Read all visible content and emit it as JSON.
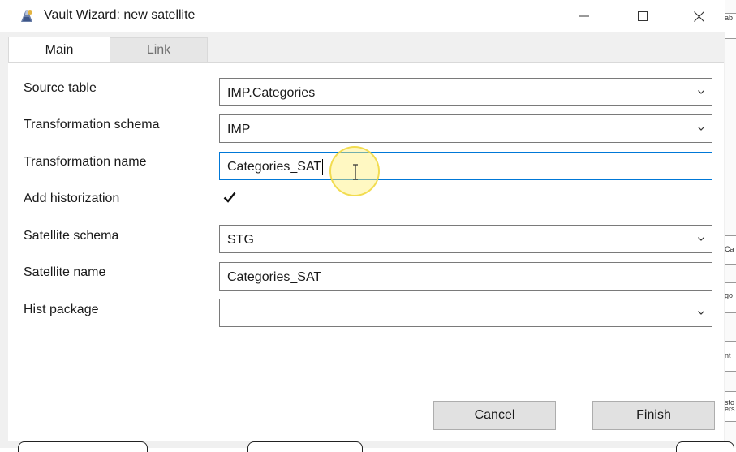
{
  "window": {
    "title": "Vault Wizard: new satellite",
    "controls": {
      "minimize": "minimize-icon",
      "maximize": "maximize-icon",
      "close": "close-icon"
    }
  },
  "tabs": [
    {
      "label": "Main",
      "selected": true
    },
    {
      "label": "Link",
      "selected": false
    }
  ],
  "form": {
    "source_table": {
      "label": "Source table",
      "value": "IMP.Categories"
    },
    "transformation_schema": {
      "label": "Transformation schema",
      "value": "IMP"
    },
    "transformation_name": {
      "label": "Transformation name",
      "value": "Categories_SAT"
    },
    "add_historization": {
      "label": "Add historization",
      "checked": true
    },
    "satellite_schema": {
      "label": "Satellite schema",
      "value": "STG"
    },
    "satellite_name": {
      "label": "Satellite name",
      "value": "Categories_SAT"
    },
    "hist_package": {
      "label": "Hist package",
      "value": ""
    }
  },
  "buttons": {
    "cancel": "Cancel",
    "finish": "Finish"
  },
  "background_fragments": [
    "ab",
    "Ca",
    "go",
    "nt",
    "sto",
    "ers"
  ],
  "colors": {
    "focus_border": "#0078d7",
    "cursor_highlight": "#fff078"
  }
}
